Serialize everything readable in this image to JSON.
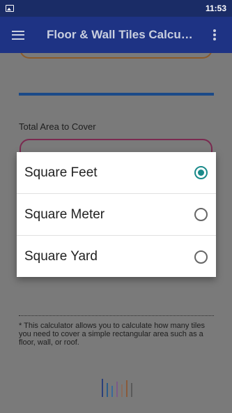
{
  "status_bar": {
    "time": "11:53",
    "notification_icon": "image-icon"
  },
  "app_bar": {
    "title": "Floor & Wall Tiles Calcu…",
    "menu_icon": "hamburger-menu-icon",
    "overflow_icon": "more-vert-icon"
  },
  "form": {
    "area_label": "Total Area to Cover",
    "note": "* This calculator allows you to calculate how many tiles you need to cover a simple rectangular area such as a floor, wall, or roof."
  },
  "dialog": {
    "options": [
      {
        "label": "Square Feet",
        "selected": true
      },
      {
        "label": "Square Meter",
        "selected": false
      },
      {
        "label": "Square Yard",
        "selected": false
      }
    ]
  },
  "colors": {
    "app_bar": "#1e3384",
    "status_bar": "#1a2c66",
    "radio_accent": "#1a8a8a"
  }
}
